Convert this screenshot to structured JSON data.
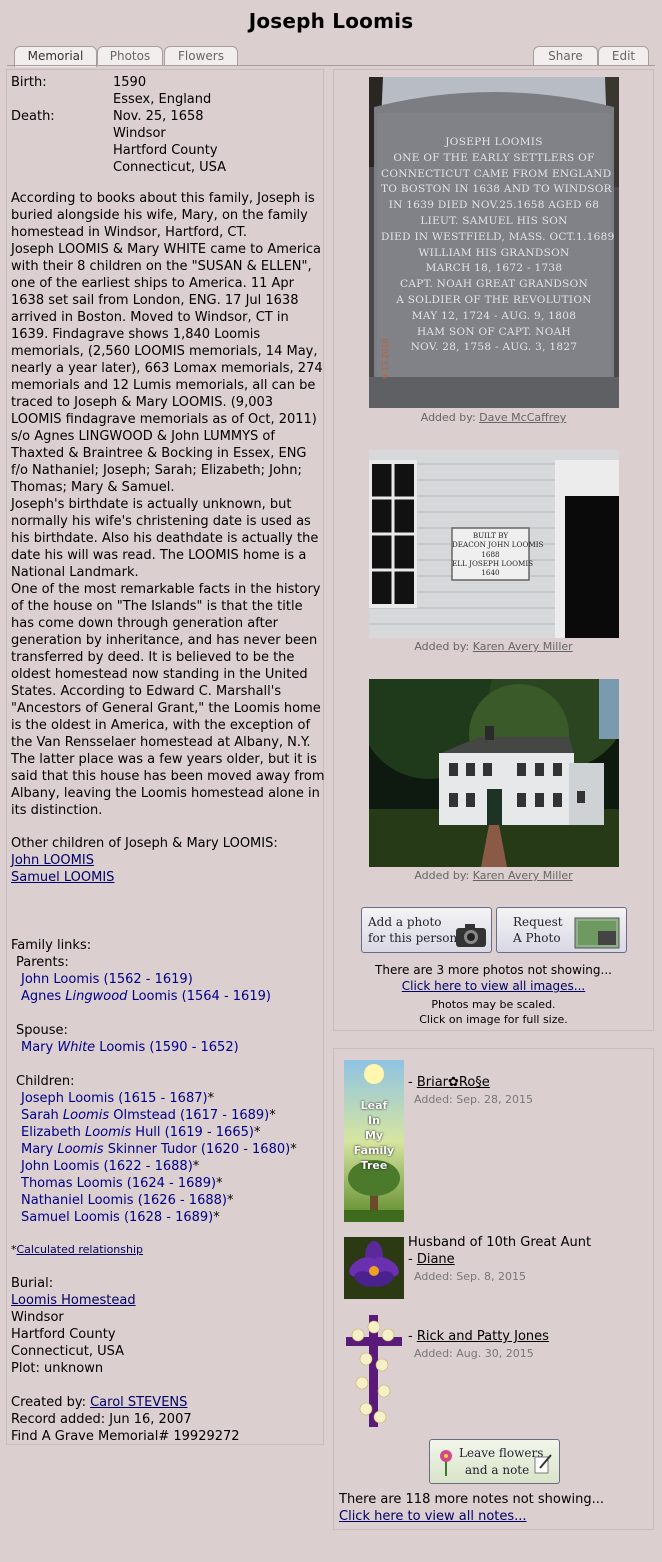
{
  "page_title": "Joseph Loomis",
  "tabs": {
    "memorial": "Memorial",
    "photos": "Photos",
    "flowers": "Flowers",
    "share": "Share",
    "edit": "Edit"
  },
  "facts": {
    "birth_label": "Birth:",
    "birth_date": "1590",
    "birth_place": "Essex, England",
    "death_label": "Death:",
    "death_date": "Nov. 25, 1658",
    "death_place1": "Windsor",
    "death_place2": "Hartford County",
    "death_place3": "Connecticut, USA"
  },
  "bio": [
    "According to books about this family, Joseph is buried alongside his wife, Mary, on the family homestead in Windsor, Hartford, CT.",
    "Joseph LOOMIS & Mary WHITE came to America with their 8 children on the \"SUSAN & ELLEN\", one of the earliest ships to America. 11 Apr 1638 set sail from London, ENG. 17 Jul 1638 arrived in Boston. Moved to Windsor, CT in 1639. Findagrave shows 1,840 Loomis memorials, (2,560 LOOMIS memorials, 14 May, nearly a year later), 663 Lomax memorials, 274 memorials and 12 Lumis memorials, all can be traced to Joseph & Mary LOOMIS. (9,003 LOOMIS findagrave memorials as of Oct, 2011) s/o Agnes LINGWOOD & John LUMMYS of Thaxted & Braintree & Bocking in Essex, ENG f/o Nathaniel; Joseph; Sarah; Elizabeth; John; Thomas; Mary & Samuel.",
    "Joseph's birthdate is actually unknown, but normally his wife's christening date is used as his birthdate. Also his deathdate is actually the date his will was read. The LOOMIS home is a National Landmark.",
    "One of the most remarkable facts in the history of the house on \"The Islands\" is that the title has come down through generation after generation by inheritance, and has never been transferred by deed. It is believed to be the oldest homestead now standing in the United States. According to Edward C. Marshall's \"Ancestors of General Grant,\" the Loomis home is the oldest in America, with the exception of the Van Rensselaer homestead at Albany, N.Y. The latter place was a few years older, but it is said that this house has been moved away from Albany, leaving the Loomis homestead alone in its distinction."
  ],
  "other_children": {
    "heading": "Other children of Joseph & Mary LOOMIS:",
    "links": [
      "John LOOMIS",
      "Samuel LOOMIS"
    ]
  },
  "family": {
    "heading": "Family links:",
    "parents_label": "Parents:",
    "parents": [
      {
        "pre": "John Loomis",
        "ital": "",
        "post": " (1562 - 1619)",
        "star": ""
      },
      {
        "pre": "Agnes ",
        "ital": "Lingwood",
        "post": " Loomis (1564 - 1619)",
        "star": ""
      }
    ],
    "spouse_label": "Spouse:",
    "spouse": [
      {
        "pre": "Mary ",
        "ital": "White",
        "post": " Loomis (1590 - 1652)",
        "star": ""
      }
    ],
    "children_label": "Children:",
    "children": [
      {
        "pre": "Joseph Loomis (1615 - 1687)",
        "ital": "",
        "post": "",
        "star": "*"
      },
      {
        "pre": "Sarah ",
        "ital": "Loomis",
        "post": " Olmstead (1617 - 1689)",
        "star": "*"
      },
      {
        "pre": "Elizabeth ",
        "ital": "Loomis",
        "post": " Hull (1619 - 1665)",
        "star": "*"
      },
      {
        "pre": "Mary ",
        "ital": "Loomis",
        "post": " Skinner Tudor (1620 - 1680)",
        "star": "*"
      },
      {
        "pre": "John Loomis (1622 - 1688)",
        "ital": "",
        "post": "",
        "star": "*"
      },
      {
        "pre": "Thomas Loomis (1624 - 1689)",
        "ital": "",
        "post": "",
        "star": "*"
      },
      {
        "pre": "Nathaniel Loomis (1626 - 1688)",
        "ital": "",
        "post": "",
        "star": "*"
      },
      {
        "pre": "Samuel Loomis (1628 - 1689)",
        "ital": "",
        "post": "",
        "star": "*"
      }
    ],
    "calc_star": "*",
    "calc_link": "Calculated relationship"
  },
  "burial": {
    "label": "Burial:",
    "cemetery": "Loomis Homestead",
    "l1": "Windsor",
    "l2": "Hartford County",
    "l3": "Connecticut, USA",
    "plot": "Plot: unknown"
  },
  "record": {
    "created_label": "Created by: ",
    "created_by": "Carol STEVENS",
    "added": "Record added: Jun 16, 2007",
    "memorial": "Find A Grave Memorial# 19929272"
  },
  "photos": {
    "items": [
      {
        "added_label": "Added by: ",
        "by": "Dave McCaffrey"
      },
      {
        "added_label": "Added by: ",
        "by": "Karen Avery Miller"
      },
      {
        "added_label": "Added by: ",
        "by": "Karen Avery Miller"
      }
    ],
    "headstone_lines": [
      "JOSEPH LOOMIS",
      "ONE OF THE EARLY SETTLERS OF",
      "CONNECTICUT CAME FROM ENGLAND",
      "TO BOSTON IN 1638 AND TO WINDSOR",
      "IN 1639 DIED NOV.25.1658 AGED 68",
      "LIEUT. SAMUEL  HIS SON",
      "DIED IN WESTFIELD, MASS. OCT.1.1689",
      "WILLIAM  HIS GRANDSON",
      "MARCH 18, 1672 -          1738",
      "CAPT. NOAH  GREAT GRANDSON",
      "A SOLDIER OF THE REVOLUTION",
      "MAY 12, 1724 - AUG. 9, 1808",
      "HAM  SON OF CAPT. NOAH",
      "NOV. 28, 1758 - AUG. 3, 1827"
    ],
    "sign_lines": [
      "BUILT  BY",
      "DEACON JOHN LOOMIS",
      "1688",
      "ELL  JOSEPH LOOMIS",
      "1640"
    ],
    "add_photo_btn": [
      "Add a photo",
      "for this person"
    ],
    "request_photo_btn": [
      "Request",
      "A Photo"
    ],
    "more_text": "There are 3 more photos not showing...",
    "view_all": "Click here to view all images...",
    "scaled1": "Photos may be scaled.",
    "scaled2": "Click on image for full size."
  },
  "flowers": {
    "notes": [
      {
        "message": "",
        "dash": "- ",
        "author": "Briar✿Ro§e",
        "added": "Added: Sep. 28, 2015",
        "img_text": [
          "Leaf",
          "In",
          "My",
          "Family",
          "Tree"
        ]
      },
      {
        "message": "Husband of 10th Great Aunt",
        "dash": "- ",
        "author": "Diane",
        "added": "Added: Sep. 8, 2015"
      },
      {
        "message": "",
        "dash": "- ",
        "author": "Rick and Patty Jones",
        "added": "Added: Aug. 30, 2015"
      }
    ],
    "leave_btn": [
      "Leave flowers",
      "and a note"
    ],
    "more_text": "There are 118 more notes not showing...",
    "view_all": "Click here to view all notes..."
  }
}
